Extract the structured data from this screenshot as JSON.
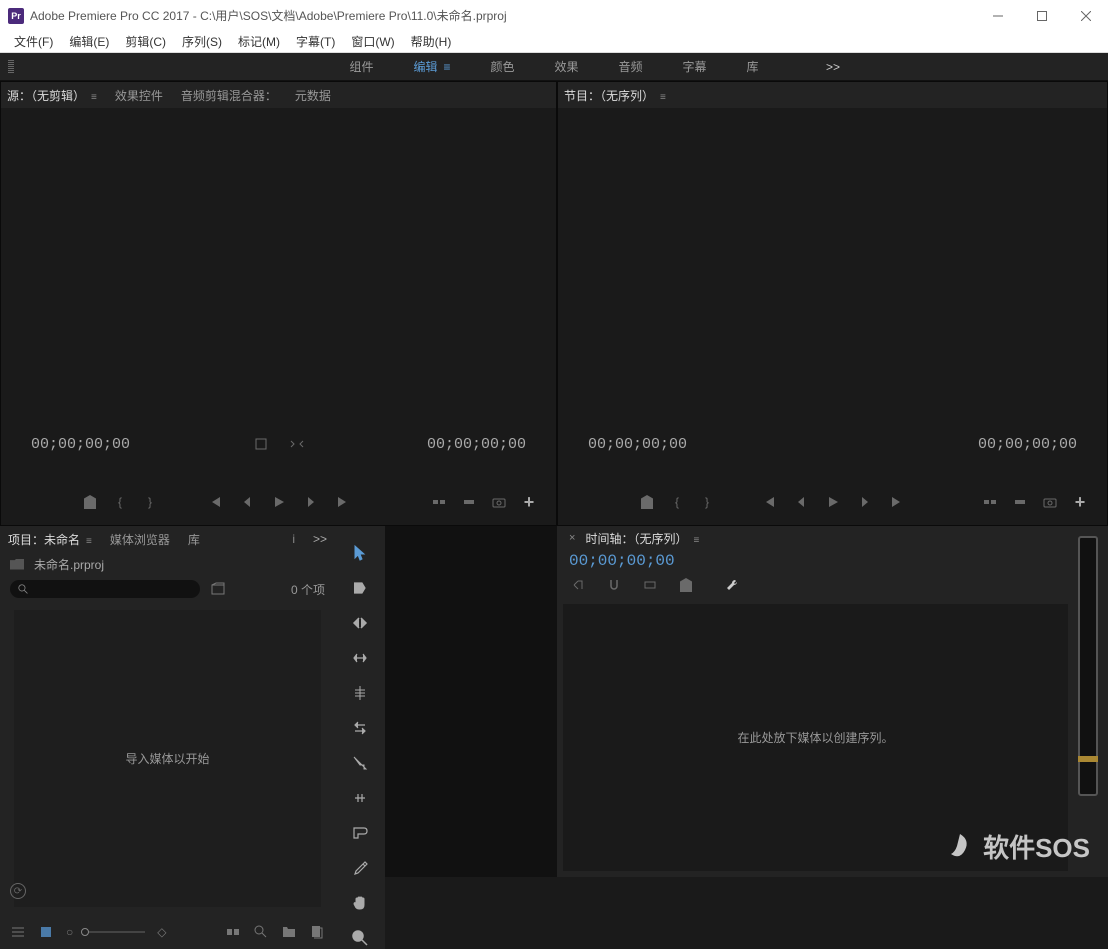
{
  "app": {
    "title": "Adobe Premiere Pro CC 2017 - C:\\用户\\SOS\\文档\\Adobe\\Premiere Pro\\11.0\\未命名.prproj",
    "icon_label": "Pr"
  },
  "menu": {
    "items": [
      "文件(F)",
      "编辑(E)",
      "剪辑(C)",
      "序列(S)",
      "标记(M)",
      "字幕(T)",
      "窗口(W)",
      "帮助(H)"
    ]
  },
  "workspaces": {
    "items": [
      "组件",
      "编辑",
      "颜色",
      "效果",
      "音频",
      "字幕",
      "库"
    ],
    "active": "编辑",
    "chevron": ">>"
  },
  "source_monitor": {
    "tabs": [
      "源：（无剪辑）",
      "效果控件",
      "音频剪辑混合器：",
      "元数据"
    ],
    "active_tab": 0,
    "tc_left": "00;00;00;00",
    "tc_right": "00;00;00;00"
  },
  "program_monitor": {
    "tab": "节目：（无序列）",
    "tc_left": "00;00;00;00",
    "tc_right": "00;00;00;00"
  },
  "project": {
    "tabs": [
      "项目：未命名",
      "媒体浏览器",
      "库"
    ],
    "chevron": ">>",
    "filename": "未命名.prproj",
    "item_count": "0 个项",
    "placeholder": "导入媒体以开始"
  },
  "timeline": {
    "tab": "时间轴：（无序列）",
    "tc": "00;00;00;00",
    "placeholder": "在此处放下媒体以创建序列。"
  },
  "watermark": {
    "text": "软件SOS"
  }
}
